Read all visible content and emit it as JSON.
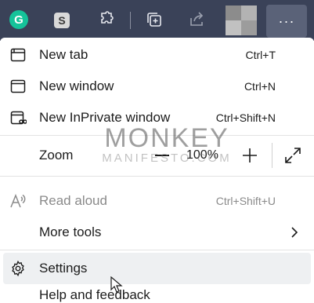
{
  "toolbar": {
    "grammarly_glyph": "G",
    "s_extension_glyph": "S",
    "more_button_glyph": "···",
    "icons": [
      "grammarly-extension-icon",
      "s-extension-icon",
      "extensions-icon",
      "collections-icon",
      "share-icon",
      "profile-avatar",
      "more-icon"
    ]
  },
  "menu": {
    "new_tab": {
      "label": "New tab",
      "shortcut": "Ctrl+T",
      "icon": "new-tab-icon"
    },
    "new_window": {
      "label": "New window",
      "shortcut": "Ctrl+N",
      "icon": "window-icon"
    },
    "new_inprivate": {
      "label": "New InPrivate window",
      "shortcut": "Ctrl+Shift+N",
      "icon": "inprivate-icon"
    },
    "zoom": {
      "label": "Zoom",
      "value": "100%",
      "minus_icon": "zoom-out-icon",
      "plus_icon": "zoom-in-icon",
      "fullscreen_icon": "fullscreen-icon"
    },
    "read_aloud": {
      "label": "Read aloud",
      "shortcut": "Ctrl+Shift+U",
      "icon": "read-aloud-icon",
      "disabled": true
    },
    "more_tools": {
      "label": "More tools",
      "icon": "chevron-right-icon"
    },
    "settings": {
      "label": "Settings",
      "icon": "gear-icon"
    },
    "cut_off_item": {
      "label": "Help and feedback"
    }
  },
  "watermark": {
    "line1": "MONKEY",
    "line2": "MANIFESTO.COM"
  },
  "colors": {
    "toolbar_bg": "#3a4258",
    "menu_bg": "#ffffff",
    "hover_bg": "#eef0f2",
    "grammarly": "#15c39a"
  }
}
